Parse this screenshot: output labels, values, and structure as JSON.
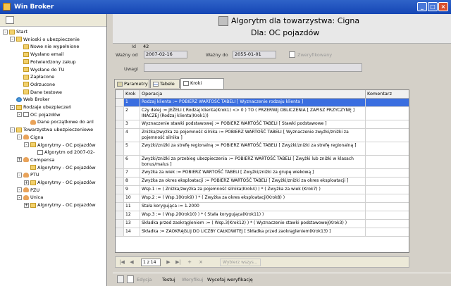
{
  "window": {
    "title": "Win Broker"
  },
  "tree": [
    {
      "label": "Start",
      "level": 0,
      "icon": "folder-icon",
      "exp": "-"
    },
    {
      "label": "Wnioski o ubezpieczenie",
      "level": 1,
      "icon": "folder-icon",
      "exp": "-"
    },
    {
      "label": "Nowe nie wypełnione",
      "level": 2,
      "icon": "folder-icon",
      "exp": ""
    },
    {
      "label": "Wysłano email",
      "level": 2,
      "icon": "folder-icon",
      "exp": ""
    },
    {
      "label": "Potwierdzony zakup",
      "level": 2,
      "icon": "folder-icon",
      "exp": ""
    },
    {
      "label": "Wysłane do TU",
      "level": 2,
      "icon": "folder-icon",
      "exp": ""
    },
    {
      "label": "Zapłacone",
      "level": 2,
      "icon": "folder-icon",
      "exp": ""
    },
    {
      "label": "Odrzucone",
      "level": 2,
      "icon": "folder-icon",
      "exp": ""
    },
    {
      "label": "Dane testowe",
      "level": 2,
      "icon": "folder-icon",
      "exp": ""
    },
    {
      "label": "Web Broker",
      "level": 1,
      "icon": "globe-icon",
      "exp": ""
    },
    {
      "label": "Rodzaje ubezpieczeń",
      "level": 1,
      "icon": "folder-icon",
      "exp": "-"
    },
    {
      "label": "OC pojazdów",
      "level": 2,
      "icon": "document-icon",
      "exp": "-"
    },
    {
      "label": "Dane początkowe do anl",
      "level": 3,
      "icon": "person-icon",
      "exp": ""
    },
    {
      "label": "Towarzystwa ubezpieczeniowe",
      "level": 1,
      "icon": "folder-icon",
      "exp": "-"
    },
    {
      "label": "Cigna",
      "level": 2,
      "icon": "person-icon",
      "exp": "-"
    },
    {
      "label": "Algorytmy - OC pojazdów",
      "level": 3,
      "icon": "folder-icon",
      "exp": "-"
    },
    {
      "label": "Algorytm od 2007-02-",
      "level": 4,
      "icon": "checkbox-icon",
      "exp": ""
    },
    {
      "label": "Compensa",
      "level": 2,
      "icon": "person-icon",
      "exp": "+"
    },
    {
      "label": "Algorytmy - OC pojazdów",
      "level": 3,
      "icon": "folder-icon",
      "exp": ""
    },
    {
      "label": "PTU",
      "level": 2,
      "icon": "person-icon",
      "exp": "-"
    },
    {
      "label": "Algorytmy - OC pojazdów",
      "level": 3,
      "icon": "folder-icon",
      "exp": "+"
    },
    {
      "label": "PZU",
      "level": 2,
      "icon": "person-icon",
      "exp": "-"
    },
    {
      "label": "Unica",
      "level": 2,
      "icon": "person-icon",
      "exp": "-"
    },
    {
      "label": "Algorytmy - OC pojazdów",
      "level": 3,
      "icon": "folder-icon",
      "exp": "+"
    }
  ],
  "header": {
    "title_line1": "Algorytm dla towarzystwa: Cigna",
    "title_line2": "Dla: OC pojazdów"
  },
  "form": {
    "id_label": "Id",
    "id_value": "42",
    "valid_from_label": "Ważny od",
    "valid_from_value": "2007-02-16",
    "valid_to_label": "Ważny do",
    "valid_to_value": "2055-01-01",
    "verified_label": "Zweryfikowany",
    "notes_label": "Uwagi",
    "notes_value": ""
  },
  "tabs": [
    {
      "label": "Parametry",
      "active": false
    },
    {
      "label": "Tabele",
      "active": false
    },
    {
      "label": "Kroki obliczeń",
      "active": true
    }
  ],
  "grid": {
    "columns": [
      "Krok",
      "Operacja",
      "Komentarz"
    ],
    "rows": [
      {
        "step": "1",
        "op": "Rodzaj klienta := POBIERZ WARTOŚĆ TABELI [ Wyznaczenie rodzaju klienta ]",
        "comment": "",
        "selected": true
      },
      {
        "step": "2",
        "op": "Czy delej := JEŻELI ( Rodzaj klienta(Krok1) <> 0 ) TO ( PRZERWIJ OBLICZENIA [ ZAPISZ PRZYCZYNĘ ] INACZEJ (Rodzaj klienta(Krok1))",
        "comment": "",
        "selected": false
      },
      {
        "step": "3",
        "op": "Wyznaczenie stawki podstawowej := POBIERZ WARTOŚĆ TABELI [ Stawki podstawowe ]",
        "comment": "",
        "selected": false
      },
      {
        "step": "4",
        "op": "Zniżka/zwyżka za pojemność silnika := POBIERZ WARTOŚĆ TABELI [ Wyznaczenie zwyżki/zniżki za pojemność silnika ]",
        "comment": "",
        "selected": false
      },
      {
        "step": "5",
        "op": "Zwyżki/zniżki za strefę regionalną := POBIERZ WARTOŚĆ TABELI [ Zwyżki/zniżki za strefę regionalną ]",
        "comment": "",
        "selected": false
      },
      {
        "step": "6",
        "op": "Zwyżki/zniżki za przebieg ubezpieczenia := POBIERZ WARTOŚĆ TABELI [ Zwyżki lub zniżki w klasach bonus/malus ]",
        "comment": "",
        "selected": false
      },
      {
        "step": "7",
        "op": "Zwyżka za wiek := POBIERZ WARTOŚĆ TABELI [ Zwyżki/zniżki za grupę wiekową ]",
        "comment": "",
        "selected": false
      },
      {
        "step": "8",
        "op": "Zwyżka za okres eksploatacji := POBIERZ WARTOŚĆ TABELI [ Zwyżki/zniżki za okres eksploatacji ]",
        "comment": "",
        "selected": false
      },
      {
        "step": "9",
        "op": "Wsp.1 := ( Zniżka/zwyżka za pojemność silnika(Krok4) ) * ( Zwyżka za wiek (Krok7) )",
        "comment": "",
        "selected": false
      },
      {
        "step": "10",
        "op": "Wsp.2 := ( Wsp.1(Krok9) ) * ( Zwyżka za okres eksploatacji(Krok8) )",
        "comment": "",
        "selected": false
      },
      {
        "step": "11",
        "op": "Stała korygująca := 1.2000",
        "comment": "",
        "selected": false
      },
      {
        "step": "12",
        "op": "Wsp.3 := ( Wsp.2(Krok10) ) * ( Stała korygująca(Krok11) )",
        "comment": "",
        "selected": false
      },
      {
        "step": "13",
        "op": "Składka przed zaokrągleniem := ( Wsp.3(Krok12) ) * ( Wyznaczenie stawki podstawowej(Krok3) )",
        "comment": "",
        "selected": false
      },
      {
        "step": "14",
        "op": "Składka := ZAOKRĄGLIJ DO LICZBY CAŁKOWITEJ [ Składka przed zaokrągleniem(Krok13) ]",
        "comment": "",
        "selected": false
      }
    ]
  },
  "navigator": {
    "position": "1 z 14",
    "select_label": "Wybierz wszys..."
  },
  "bottom": {
    "edit_label": "Edycja",
    "test_label": "Testuj",
    "verify_label": "Weryfikuj",
    "unverify_label": "Wycofaj weryfikację"
  }
}
